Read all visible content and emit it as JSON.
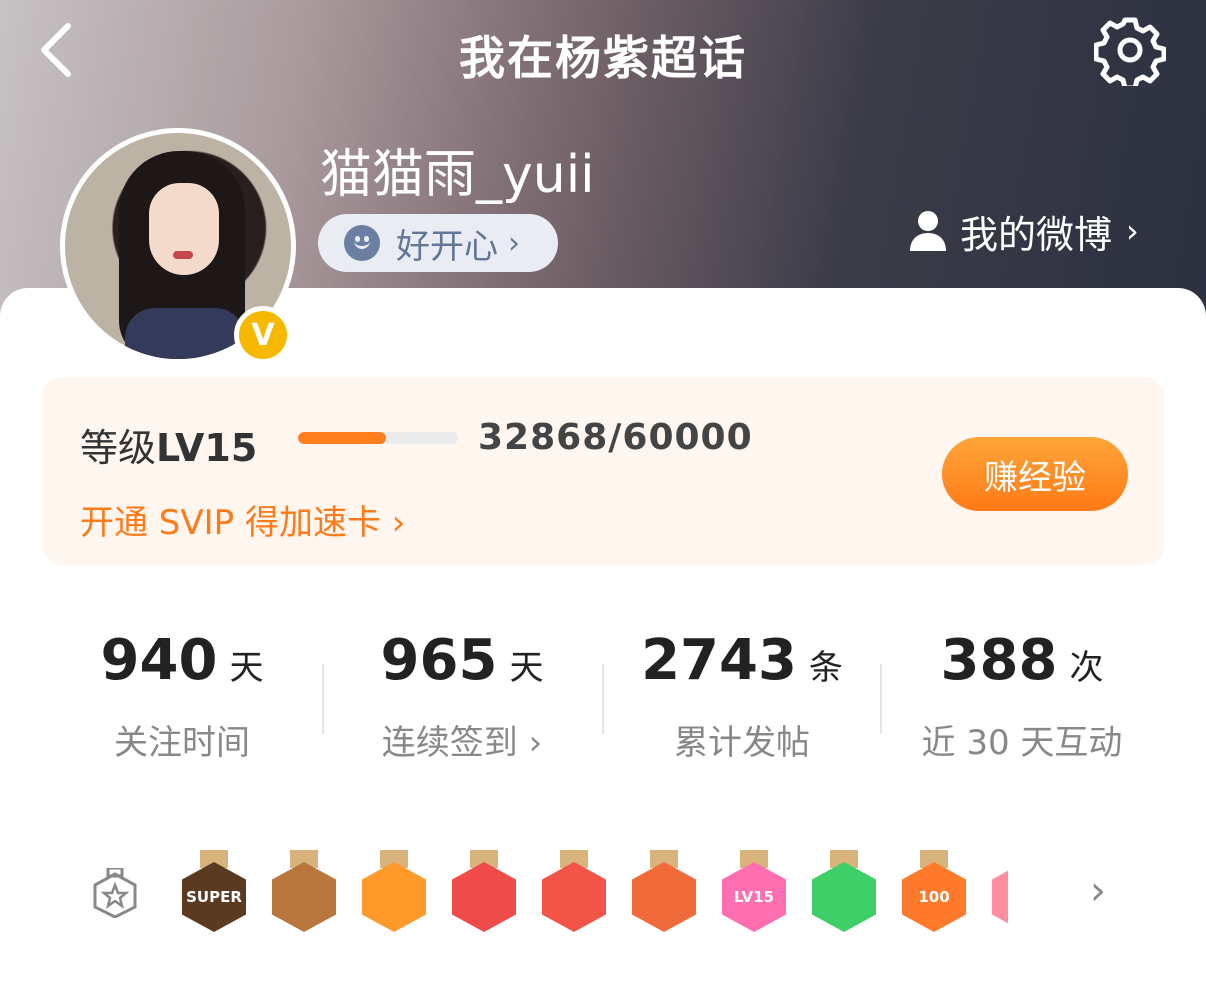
{
  "header": {
    "title": "我在杨紫超话",
    "username": "猫猫雨_yuii",
    "mood": {
      "label": "好开心",
      "chevron": "›",
      "icon": "smiley-icon"
    },
    "my_weibo": {
      "label": "我的微博",
      "chevron": "›",
      "icon": "person-icon"
    },
    "back_icon": "chevron-left-icon",
    "settings_icon": "gear-icon"
  },
  "verified_badge": "V",
  "level": {
    "label": "等级",
    "level": "LV15",
    "progress_text": "32868/60000",
    "progress_fraction": 0.55,
    "svip_link": "开通 SVIP 得加速卡 ›",
    "earn_button": "赚经验"
  },
  "stats": [
    {
      "value": "940",
      "unit": "天",
      "label": "关注时间"
    },
    {
      "value": "965",
      "unit": "天",
      "label": "连续签到 ›"
    },
    {
      "value": "2743",
      "unit": "条",
      "label": "累计发帖"
    },
    {
      "value": "388",
      "unit": "次",
      "label": "近 30 天互动"
    }
  ],
  "badges": {
    "icon": "hexagon-star-icon",
    "chevron": "›",
    "items": [
      {
        "name": "super-medal",
        "text": "SUPER",
        "color": "#5b3a22"
      },
      {
        "name": "monkey-medal",
        "text": "",
        "color": "#b8763d"
      },
      {
        "name": "crown-medal",
        "text": "",
        "color": "#ff9a2a"
      },
      {
        "name": "dragon-medal-1",
        "text": "",
        "color": "#f04b4b"
      },
      {
        "name": "dragon-medal-2",
        "text": "",
        "color": "#f25548"
      },
      {
        "name": "dragon-medal-3",
        "text": "",
        "color": "#f06a3a"
      },
      {
        "name": "lv15-medal",
        "text": "LV15",
        "color": "#ff6fb0"
      },
      {
        "name": "hand-medal",
        "text": "",
        "color": "#3fcf68"
      },
      {
        "name": "100days-medal",
        "text": "100",
        "color": "#ff7a2a"
      },
      {
        "name": "partial-medal",
        "text": "",
        "color": "#ff8fa0"
      }
    ]
  }
}
